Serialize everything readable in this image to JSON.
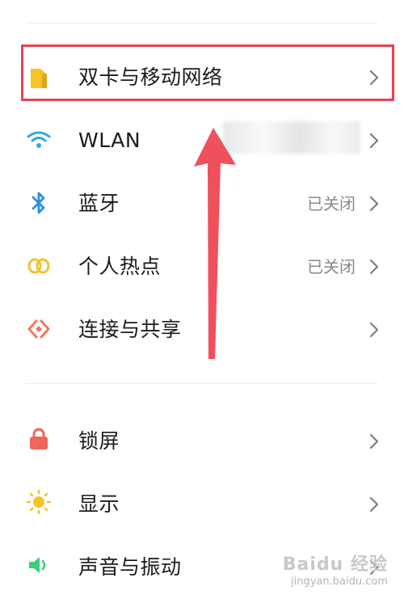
{
  "settings": {
    "group1": [
      {
        "label": "双卡与移动网络",
        "status": "",
        "icon": "sim-card-icon",
        "color": "#f5c428"
      },
      {
        "label": "WLAN",
        "status": "",
        "icon": "wifi-icon",
        "color": "#2aa8e8"
      },
      {
        "label": "蓝牙",
        "status": "已关闭",
        "icon": "bluetooth-icon",
        "color": "#2a8fe8"
      },
      {
        "label": "个人热点",
        "status": "已关闭",
        "icon": "hotspot-icon",
        "color": "#f2c12e"
      },
      {
        "label": "连接与共享",
        "status": "",
        "icon": "connection-share-icon",
        "color": "#f07a57"
      }
    ],
    "group2": [
      {
        "label": "锁屏",
        "status": "",
        "icon": "lock-icon",
        "color": "#f0665a"
      },
      {
        "label": "显示",
        "status": "",
        "icon": "sun-icon",
        "color": "#f5c428"
      },
      {
        "label": "声音与振动",
        "status": "",
        "icon": "speaker-icon",
        "color": "#3ccf78"
      }
    ]
  },
  "annotation": {
    "highlight_color": "#e8434e",
    "arrow_color": "#f0505c"
  },
  "watermark": {
    "brand": "Baidu 经验",
    "url": "jingyan.baidu.com"
  }
}
